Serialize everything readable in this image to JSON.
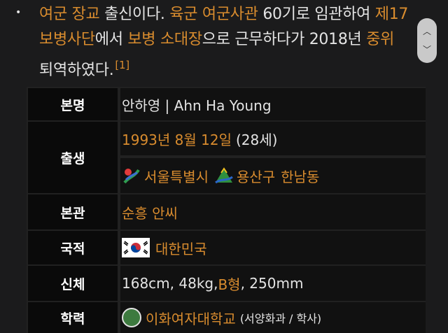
{
  "intro": {
    "bullet": "•",
    "line1": {
      "a": "여군 장교",
      "b": " 출신이다. ",
      "c": "육군",
      "d": " ",
      "e": "여군사관",
      "f": " 60기로 임관하여 ",
      "g": "제17"
    },
    "line2": {
      "a": "보병사단",
      "b": "에서 ",
      "c": "보병",
      "d": " ",
      "e": "소대장",
      "f": "으로 근무하다가 2018년 ",
      "g": "중위"
    },
    "line3": {
      "a": "퇴역하였다.",
      "ref": "[1]"
    }
  },
  "infobox": {
    "name_label": "본명",
    "name_value": "안하영 | Ahn Ha Young",
    "birth_label": "출생",
    "birth_date": "1993년 8월 12일",
    "birth_age": "(28세)",
    "birth_city": "서울특별시",
    "birth_district": "용산구",
    "birth_dong": "한남동",
    "origin_label": "본관",
    "origin_value": "순흥 안씨",
    "nation_label": "국적",
    "nation_value": "대한민국",
    "body_label": "신체",
    "body_a": "168cm, 48kg, ",
    "body_blood": "B형",
    "body_b": ", 250mm",
    "edu_label": "학력",
    "edu_school": "이화여자대학교",
    "edu_detail": "(서양화과 / 학사)"
  },
  "icons": {
    "seoul_emblem": "seoul-emblem-icon",
    "yongsan_emblem": "yongsan-emblem-icon",
    "flag": "korea-flag-icon",
    "university": "ewha-emblem-icon"
  },
  "colors": {
    "link": "#d98c2e",
    "header_bg": "#0a0a0a",
    "cell_bg": "#111111"
  }
}
